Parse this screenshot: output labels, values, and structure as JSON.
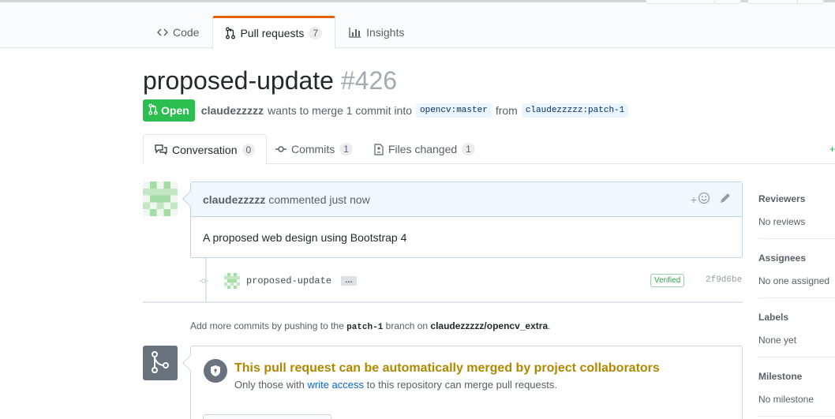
{
  "repo_nav": {
    "code_label": "Code",
    "pull_requests_label": "Pull requests",
    "pull_requests_count": "7",
    "insights_label": "Insights"
  },
  "pr": {
    "title": "proposed-update",
    "number": "#426",
    "state": "Open",
    "author": "claudezzzzz",
    "merge_text": "wants to merge 1 commit into",
    "base_branch": "opencv:master",
    "from_text": "from",
    "head_branch": "claudezzzzz:patch-1"
  },
  "tabs": {
    "conversation_label": "Conversation",
    "conversation_count": "0",
    "commits_label": "Commits",
    "commits_count": "1",
    "files_label": "Files changed",
    "files_count": "1",
    "plus": "+"
  },
  "comment": {
    "author": "claudezzzzz",
    "meta": "commented just now",
    "body": "A proposed web design using Bootstrap 4",
    "reaction_plus": "+"
  },
  "commit": {
    "message": "proposed-update",
    "ellipsis": "…",
    "verified_label": "Verified",
    "sha": "2f9d6be"
  },
  "add_commits": {
    "prefix": "Add more commits by pushing to the",
    "branch": "patch-1",
    "middle": "branch on",
    "repo": "claudezzzzz/opencv_extra",
    "suffix": "."
  },
  "merge": {
    "heading": "This pull request can be automatically merged by project collaborators",
    "sub_prefix": "Only those with",
    "sub_link": "write access",
    "sub_suffix": "to this repository can merge pull requests."
  },
  "sidebar": {
    "reviewers_title": "Reviewers",
    "reviewers_value": "No reviews",
    "assignees_title": "Assignees",
    "assignees_value": "No one assigned",
    "labels_title": "Labels",
    "labels_value": "None yet",
    "milestone_title": "Milestone",
    "milestone_value": "No milestone"
  },
  "colors": {
    "open_green": "#2cbe4e",
    "tab_accent": "#e36209",
    "merge_warning": "#b08800",
    "link_blue": "#0366d6"
  },
  "icons": {
    "code": "code-icon",
    "pull_request": "git-pull-request-icon",
    "insights": "graph-icon",
    "conversation": "comment-discussion-icon",
    "commits": "git-commit-icon",
    "files": "file-diff-icon",
    "reaction": "smiley-icon",
    "edit": "pencil-icon",
    "merge": "git-merge-icon",
    "lock": "shield-lock-icon"
  }
}
